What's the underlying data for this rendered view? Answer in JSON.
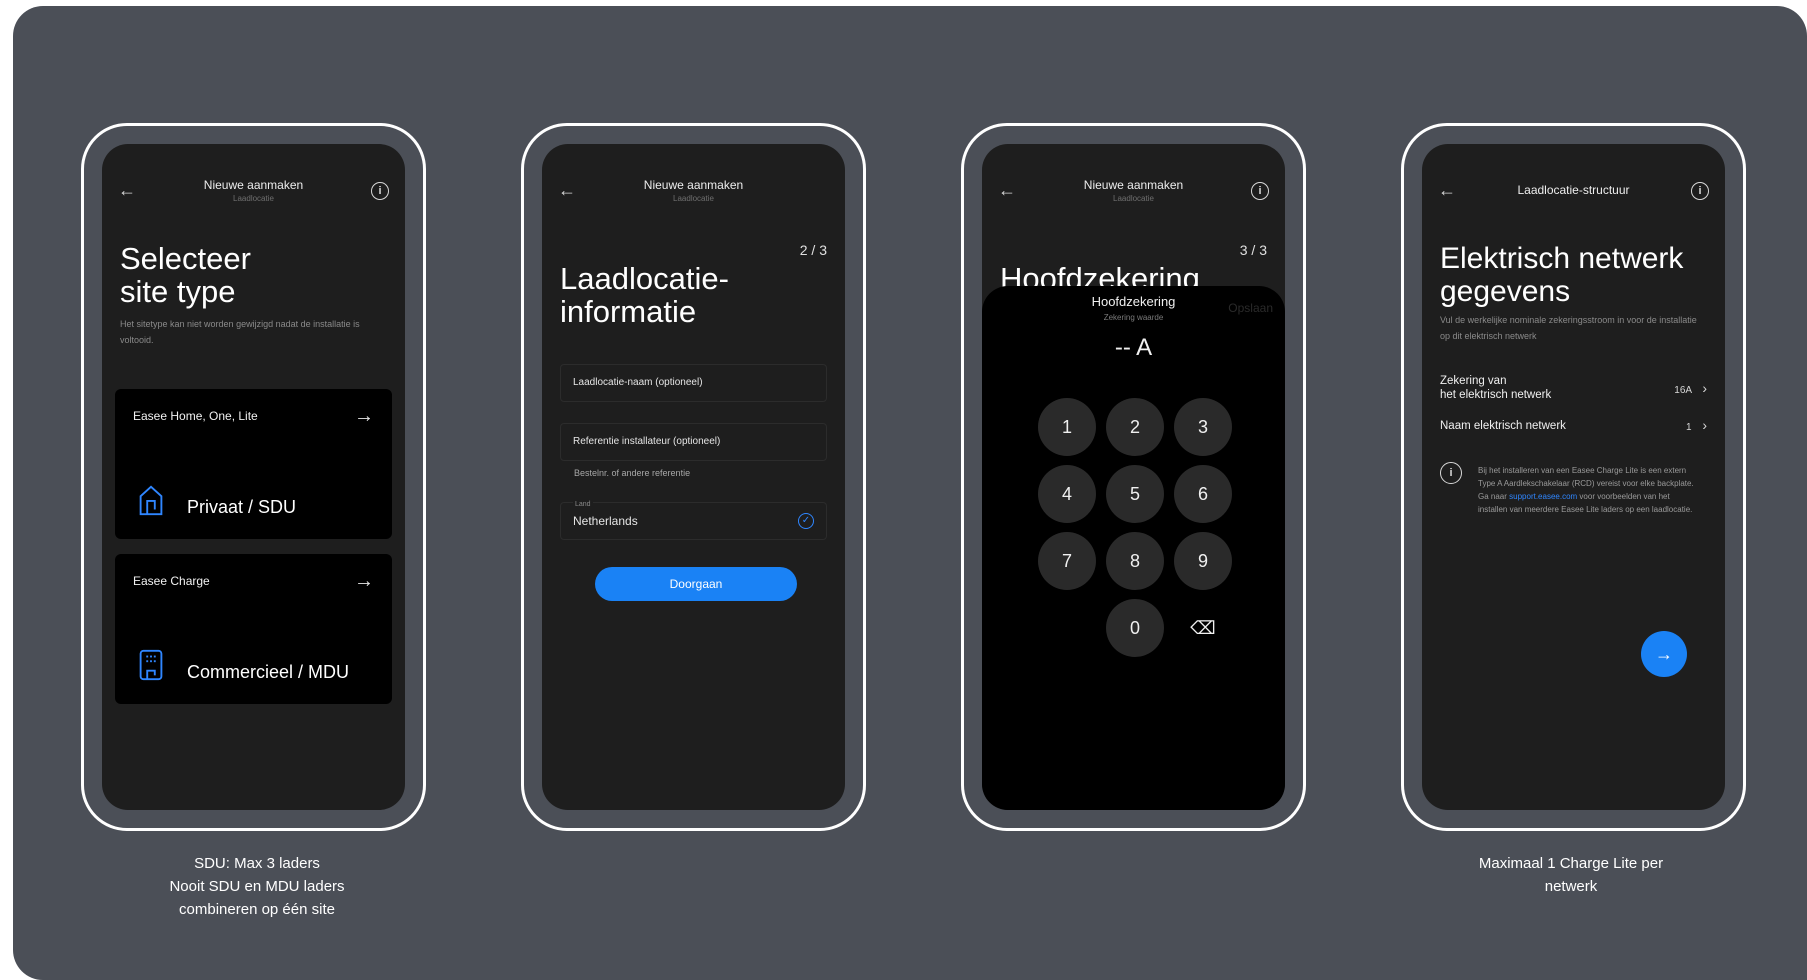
{
  "phone1": {
    "header_title": "Nieuwe aanmaken",
    "header_sub": "Laadlocatie",
    "title_line1": "Selecteer",
    "title_line2": "site type",
    "desc": "Het sitetype kan niet worden gewijzigd nadat de installatie is voltooid.",
    "card1_label": "Easee Home, One, Lite",
    "card1_main": "Privaat / SDU",
    "card2_label": "Easee Charge",
    "card2_main": "Commercieel / MDU"
  },
  "phone2": {
    "header_title": "Nieuwe aanmaken",
    "header_sub": "Laadlocatie",
    "step": "2 / 3",
    "title_line1": "Laadlocatie-",
    "title_line2": "informatie",
    "field1": "Laadlocatie-naam (optioneel)",
    "field2": "Referentie installateur (optioneel)",
    "field2_helper": "Bestelnr. of andere referentie",
    "country_label": "Land",
    "country_value": "Netherlands",
    "button": "Doorgaan"
  },
  "phone3": {
    "header_title": "Nieuwe aanmaken",
    "header_sub": "Laadlocatie",
    "step": "3 / 3",
    "title": "Hoofdzekering",
    "sheet_title": "Hoofdzekering",
    "sheet_sub": "Zekering waarde",
    "sheet_action": "Opslaan",
    "display": "-- A",
    "keys": [
      "1",
      "2",
      "3",
      "4",
      "5",
      "6",
      "7",
      "8",
      "9",
      "0"
    ]
  },
  "phone4": {
    "header_title": "Laadlocatie-structuur",
    "title_line1": "Elektrisch netwerk",
    "title_line2": "gegevens",
    "desc": "Vul de werkelijke nominale zekeringsstroom in voor de installatie op dit elektrisch netwerk",
    "row1_line1": "Zekering van",
    "row1_line2": "het elektrisch netwerk",
    "row1_value": "16A",
    "row2_label": "Naam elektrisch netwerk",
    "row2_value": "1",
    "note_a": "Bij het installeren van een Easee Charge Lite is een extern Type A Aardlekschakelaar (RCD) vereist voor elke backplate. Ga naar",
    "note_link": "support.easee.com",
    "note_b": "voor voorbeelden van het installen van meerdere Easee Lite laders op een laadlocatie."
  },
  "captions": {
    "left_line1": "SDU: Max 3 laders",
    "left_line2": "Nooit SDU en MDU laders",
    "left_line3": "combineren op één site",
    "right_line1": "Maximaal 1 Charge Lite per",
    "right_line2": "netwerk"
  },
  "icons": {
    "back": "back-arrow-icon",
    "info": "info-icon",
    "arrow": "arrow-right-icon",
    "house": "house-icon",
    "building": "building-icon",
    "check": "check-circle-icon",
    "backspace": "backspace-icon"
  },
  "colors": {
    "background": "#4b4f57",
    "screen": "#1e1e1e",
    "accent": "#1a82f5"
  }
}
